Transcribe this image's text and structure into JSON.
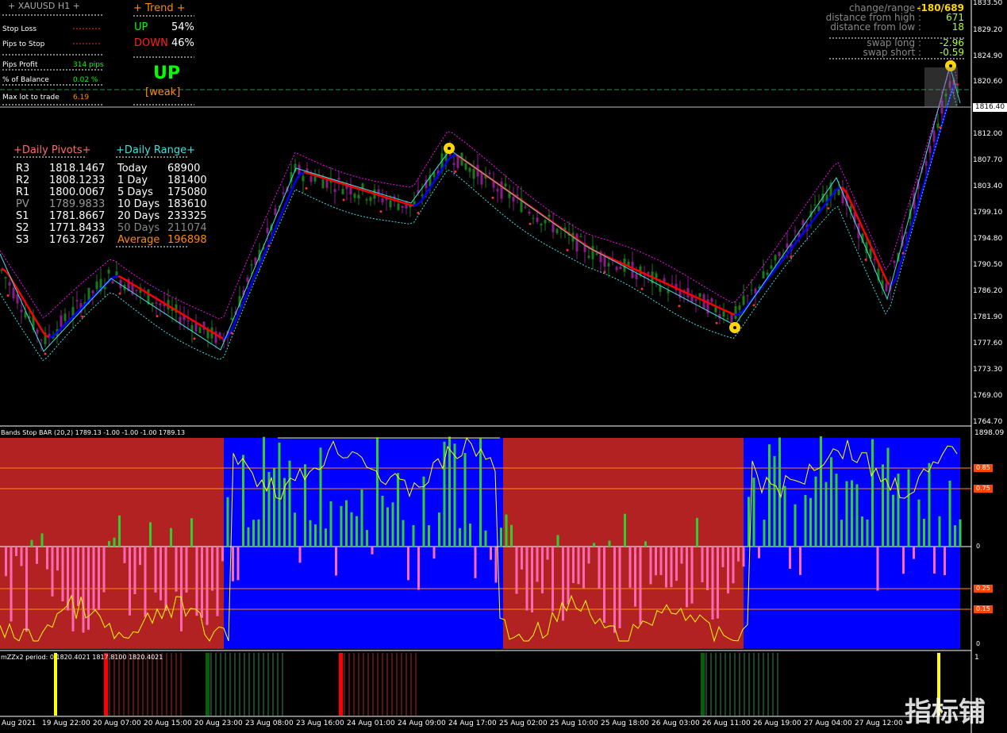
{
  "symbol": {
    "name": "XAUUSD",
    "timeframe": "H1"
  },
  "panel_left": {
    "stop_loss_label": "Stop Loss",
    "pips_to_stop_label": "Pips to Stop",
    "pips_profit_label": "Pips Profit",
    "pips_profit_value": "314 pips",
    "pct_balance_label": "% of Balance",
    "pct_balance_value": "0.02 %",
    "max_lot_label": "Max lot to trade",
    "max_lot_value": "6.19"
  },
  "trend": {
    "title": "+   Trend   +",
    "up_label": "UP",
    "up_value": "54%",
    "down_label": "DOWN",
    "down_value": "46%",
    "signal": "UP",
    "strength": "[weak]"
  },
  "stats_right": {
    "change_range_label": "change/range :",
    "change_range_value": "-180/689",
    "dist_high_label": "distance from high :",
    "dist_high_value": "671",
    "dist_low_label": "distance from low :",
    "dist_low_value": "18",
    "swap_long_label": "swap long :",
    "swap_long_value": "-2.96",
    "swap_short_label": "swap short :",
    "swap_short_value": "-0.59"
  },
  "pivots": {
    "title": "+Daily Pivots+",
    "rows": [
      {
        "label": "R3",
        "value": "1818.1467"
      },
      {
        "label": "R2",
        "value": "1808.1233"
      },
      {
        "label": "R1",
        "value": "1800.0067"
      },
      {
        "label": "PV",
        "value": "1789.9833"
      },
      {
        "label": "S1",
        "value": "1781.8667"
      },
      {
        "label": "S2",
        "value": "1771.8433"
      },
      {
        "label": "S3",
        "value": "1763.7267"
      }
    ]
  },
  "daily_range": {
    "title": "+Daily Range+",
    "rows": [
      {
        "label": "Today",
        "value": "68900"
      },
      {
        "label": "1 Day",
        "value": "181400"
      },
      {
        "label": "5 Days",
        "value": "175080"
      },
      {
        "label": "10 Days",
        "value": "183610"
      },
      {
        "label": "20 Days",
        "value": "233325"
      },
      {
        "label": "50 Days",
        "value": "211074"
      },
      {
        "label": "Average",
        "value": "196898"
      }
    ]
  },
  "price_axis": [
    "1833.50",
    "1829.20",
    "1824.90",
    "1820.60",
    "1812.00",
    "1807.70",
    "1803.40",
    "1799.10",
    "1794.80",
    "1790.50",
    "1786.20",
    "1781.90",
    "1777.60",
    "1773.30",
    "1769.00",
    "1764.70"
  ],
  "current_price": "1816.40",
  "osc": {
    "title": "Bands Stop BAR (20,2) 1789.13 -1.00 -1.00 -1.00 1789.13",
    "max_label": "1898.09",
    "levels": [
      "0.85",
      "0.75",
      "0",
      "0.25",
      "0.15",
      "0"
    ]
  },
  "zz": {
    "title": "mZZx2 period: 0  1820.4021  1817.8100  1820.4021",
    "max_label": "1"
  },
  "time_axis": [
    "Aug 2021",
    "19 Aug 22:00",
    "20 Aug 07:00",
    "20 Aug 15:00",
    "20 Aug 23:00",
    "23 Aug 08:00",
    "23 Aug 16:00",
    "24 Aug 01:00",
    "24 Aug 09:00",
    "24 Aug 17:00",
    "25 Aug 02:00",
    "25 Aug 10:00",
    "25 Aug 18:00",
    "26 Aug 03:00",
    "26 Aug 11:00",
    "26 Aug 19:00",
    "27 Aug 04:00",
    "27 Aug 12:00"
  ],
  "watermark": "指标铺",
  "colors": {
    "bull": "#1a7a1a",
    "bear": "#8b1a8b",
    "ma_red": "#ff0000",
    "ma_blue": "#0000ff",
    "zigzag": "#40e0e0",
    "osc_red": "#b22222",
    "osc_blue": "#0000ff"
  }
}
